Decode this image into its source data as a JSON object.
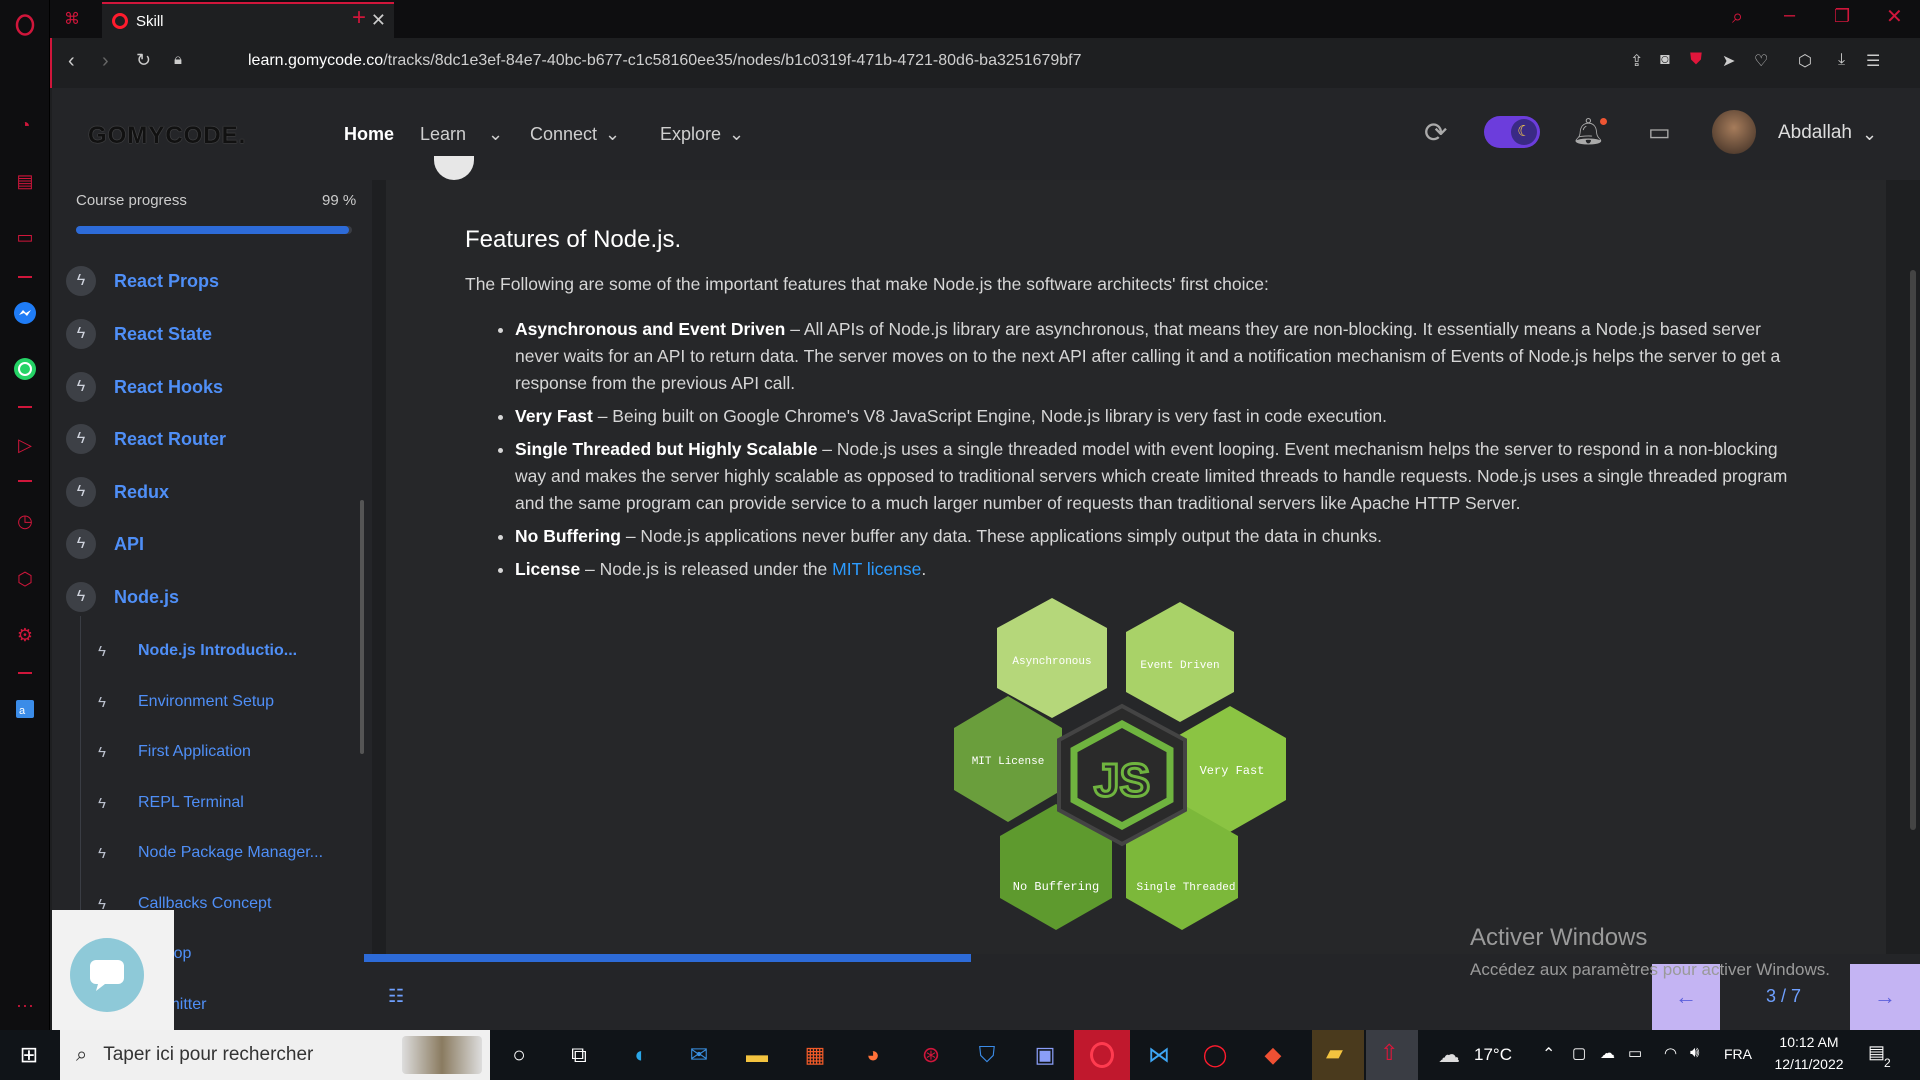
{
  "browser": {
    "tab_title": "Skill",
    "url_domain": "learn.gomycode.co",
    "url_path": "/tracks/8dc1e3ef-84e7-40bc-b677-c1c58160ee35/nodes/b1c0319f-471b-4721-80d6-ba3251679bf7"
  },
  "header": {
    "logo": "GOMYCODE.",
    "nav": {
      "home": "Home",
      "learn": "Learn",
      "connect": "Connect",
      "explore": "Explore"
    },
    "username": "Abdallah"
  },
  "sidebar": {
    "progress_label": "Course progress",
    "progress_value": "99 %",
    "progress_fraction": 0.99,
    "chapters": [
      {
        "label": "React Props"
      },
      {
        "label": "React State"
      },
      {
        "label": "React Hooks"
      },
      {
        "label": "React Router"
      },
      {
        "label": "Redux"
      },
      {
        "label": "API"
      },
      {
        "label": "Node.js"
      }
    ],
    "subitems": [
      {
        "label": "Node.js Introductio..."
      },
      {
        "label": "Environment Setup"
      },
      {
        "label": "First Application"
      },
      {
        "label": "REPL Terminal"
      },
      {
        "label": "Node Package Manager..."
      },
      {
        "label": "Callbacks Concept"
      },
      {
        "label": "nt Loop"
      },
      {
        "label": "nt Emitter"
      }
    ]
  },
  "content": {
    "heading": "Features of Node.js.",
    "intro": "The Following are some of the important features that make Node.js the software architects' first choice:",
    "features": [
      {
        "term": "Asynchronous and Event Driven",
        "text": " – All APIs of Node.js library are asynchronous, that means they are non-blocking. It essentially means a Node.js based server never waits for an API to return data. The server moves on to the next API after calling it and a notification mechanism of Events of Node.js helps the server to get a response from the previous API call."
      },
      {
        "term": "Very Fast",
        "text": " – Being built on Google Chrome's V8 JavaScript Engine, Node.js library is very fast in code execution."
      },
      {
        "term": "Single Threaded but Highly Scalable",
        "text": " – Node.js uses a single threaded model with event looping. Event mechanism helps the server to respond in a non-blocking way and makes the server highly scalable as opposed to traditional servers which create limited threads to handle requests. Node.js uses a single threaded program and the same program can provide service to a much larger number of requests than traditional servers like Apache HTTP Server."
      },
      {
        "term": "No Buffering",
        "text": " – Node.js applications never buffer any data. These applications simply output the data in chunks."
      }
    ],
    "license_term": "License",
    "license_text": " – Node.js is released under the ",
    "license_link": "MIT license",
    "license_end": ".",
    "diagram": {
      "center": "JS",
      "hexes": [
        "Asynchronous",
        "Event Driven",
        "MIT License",
        "Very Fast",
        "No Buffering",
        "Single Threaded"
      ]
    },
    "reading_progress_fraction": 0.39
  },
  "pager": {
    "page": "3 / 7"
  },
  "watermark": {
    "title": "Activer Windows",
    "subtitle": "Accédez aux paramètres pour activer Windows."
  },
  "taskbar": {
    "search_placeholder": "Taper ici pour rechercher",
    "weather": "17°C",
    "lang": "FRA",
    "time": "10:12 AM",
    "date": "12/11/2022",
    "notif_count": "2"
  }
}
